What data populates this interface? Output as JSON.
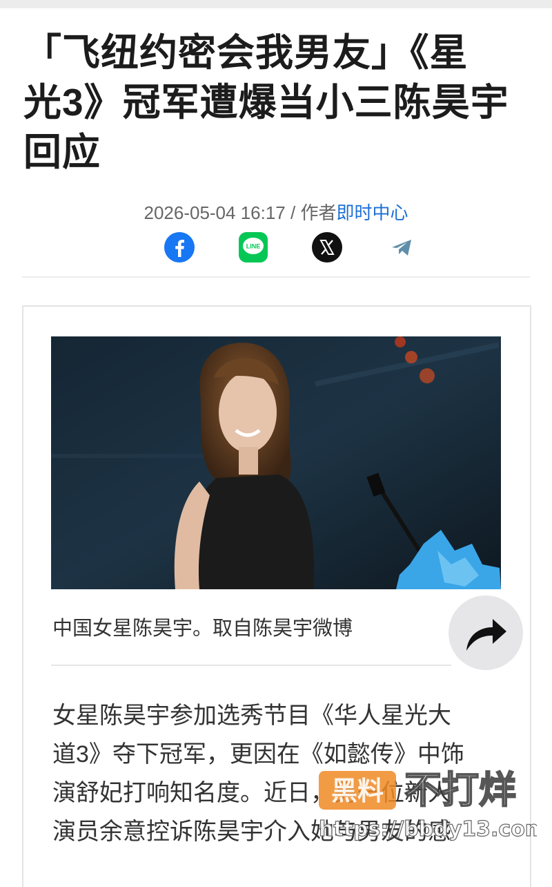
{
  "article": {
    "title_line1": "「飞纽约密会我男友」《星",
    "title_line2": "光3》冠军遭爆当小三陈昊宇",
    "title_line3": "回应",
    "date": "2026-05-04 16:17",
    "separator": "/",
    "author_prefix": "作者",
    "author": "即时中心",
    "caption": "中国女星陈昊宇。取自陈昊宇微博",
    "body_lines": [
      "女星陈昊宇参加选秀节目《华人星光大",
      "道3》夺下冠军，更因在《如懿传》中饰",
      "演舒妃打响知名度。近日，另一位新人",
      "演员余意控诉陈昊宇介入她与男友的感"
    ]
  },
  "share": {
    "icons": [
      "facebook-icon",
      "line-icon",
      "x-icon",
      "telegram-icon"
    ],
    "line_text": "LINE"
  },
  "watermark": {
    "box_text": "黑料",
    "main_text": "不打烊",
    "url": "https://bbdy13.com"
  },
  "colors": {
    "author_link": "#1d6fd6",
    "facebook": "#1877f2",
    "line": "#06c755",
    "watermark_orange": "#f08a24"
  }
}
